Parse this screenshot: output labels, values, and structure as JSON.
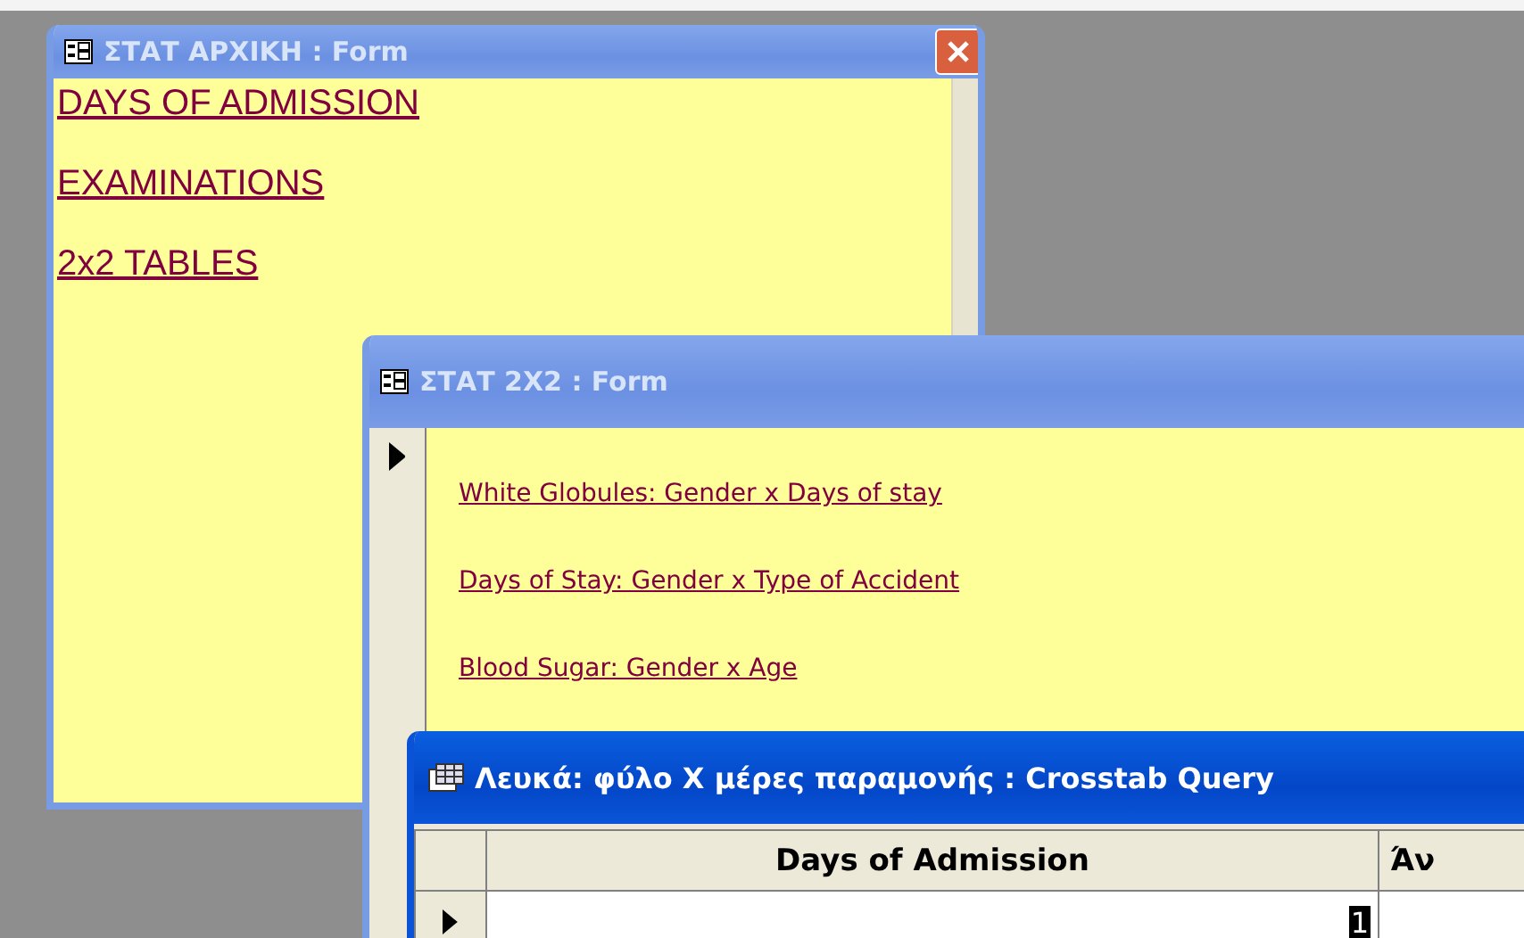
{
  "forms": [
    {
      "title": "ΣΤΑΤ ΑΡΧΙΚΗ : Form",
      "active": false,
      "closable": true,
      "record_selector": false,
      "links": [
        "DAYS OF ADMISSION",
        "EXAMINATIONS",
        "2x2 TABLES"
      ]
    },
    {
      "title": "ΣΤΑΤ 2X2 : Form",
      "active": false,
      "closable": false,
      "record_selector": true,
      "links": [
        "White Globules: Gender x Days of stay",
        "Days of Stay: Gender x Type of Accident",
        "Blood Sugar: Gender x Age"
      ]
    }
  ],
  "query": {
    "title": "Λευκά: φύλο X μέρες παραμονής : Crosstab Query",
    "active": true,
    "columns": [
      "Days of Admission",
      "Άν"
    ],
    "rows": [
      {
        "current": true,
        "cells": [
          "1"
        ]
      }
    ]
  }
}
